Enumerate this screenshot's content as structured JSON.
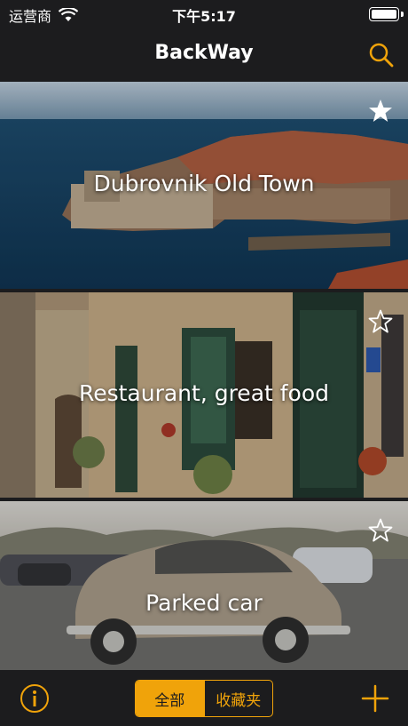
{
  "status_bar": {
    "carrier": "运营商",
    "time": "下午5:17",
    "battery_level": 1.0
  },
  "nav": {
    "title": "BackWay"
  },
  "places": [
    {
      "title": "Dubrovnik Old Town",
      "favorite": true
    },
    {
      "title": "Restaurant, great food",
      "favorite": false
    },
    {
      "title": "Parked car",
      "favorite": false
    }
  ],
  "toolbar": {
    "segments": [
      "全部",
      "收藏夹"
    ],
    "selected_segment": "全部"
  },
  "colors": {
    "accent": "#f0a30a",
    "bar_background": "#1c1c1e"
  },
  "icons": [
    "wifi-icon",
    "battery-icon",
    "search-icon",
    "star-filled-icon",
    "star-outline-icon",
    "info-icon",
    "plus-icon"
  ]
}
